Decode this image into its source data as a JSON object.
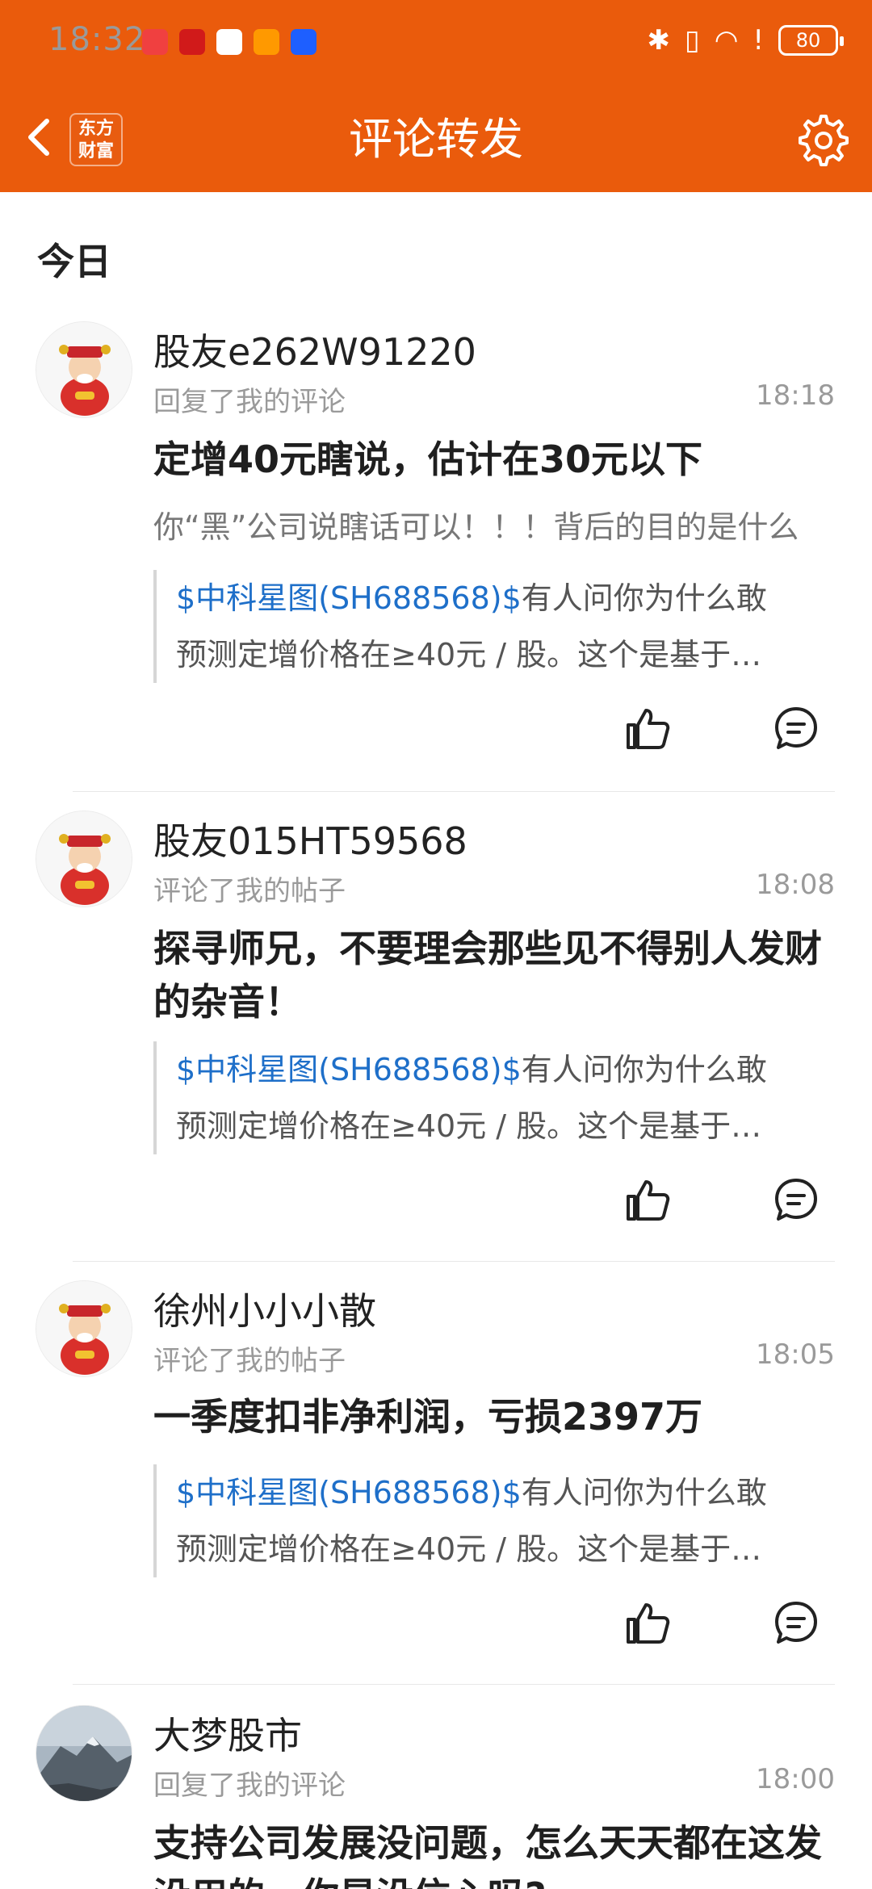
{
  "status_bar": {
    "time": "18:32",
    "battery": "80",
    "app_icon_colors": [
      "#f04040",
      "#d11a1a",
      "#ffffff",
      "#ff9900",
      "#1e5fff"
    ]
  },
  "header": {
    "title": "评论转发",
    "logo_line1": "东方",
    "logo_line2": "财富",
    "background": "#ea5b0c"
  },
  "section": {
    "label": "今日"
  },
  "items": [
    {
      "name": "股友e262W91220",
      "action": "回复了我的评论",
      "time": "18:18",
      "content": "定增40元瞎说，估计在30元以下",
      "reply": "你“黑”公司说瞎话可以！！！背后的目的是什么",
      "quote_stock": "$中科星图(SH688568)$",
      "quote_rest": "有人问你为什么敢",
      "quote_line2": "预测定增价格在≥40元 / 股。这个是基于…"
    },
    {
      "name": "股友015HT59568",
      "action": "评论了我的帖子",
      "time": "18:08",
      "content": "探寻师兄，不要理会那些见不得别人发财的杂音！",
      "quote_stock": "$中科星图(SH688568)$",
      "quote_rest": "有人问你为什么敢",
      "quote_line2": "预测定增价格在≥40元 / 股。这个是基于…"
    },
    {
      "name": "徐州小小小散",
      "action": "评论了我的帖子",
      "time": "18:05",
      "content": "一季度扣非净利润，亏损2397万",
      "quote_stock": "$中科星图(SH688568)$",
      "quote_rest": "有人问你为什么敢",
      "quote_line2": "预测定增价格在≥40元 / 股。这个是基于…"
    },
    {
      "name": "大梦股市",
      "action": "回复了我的评论",
      "time": "18:00",
      "content": "支持公司发展没问题，怎么天天都在这发没用的，你是没信心吗?"
    }
  ]
}
